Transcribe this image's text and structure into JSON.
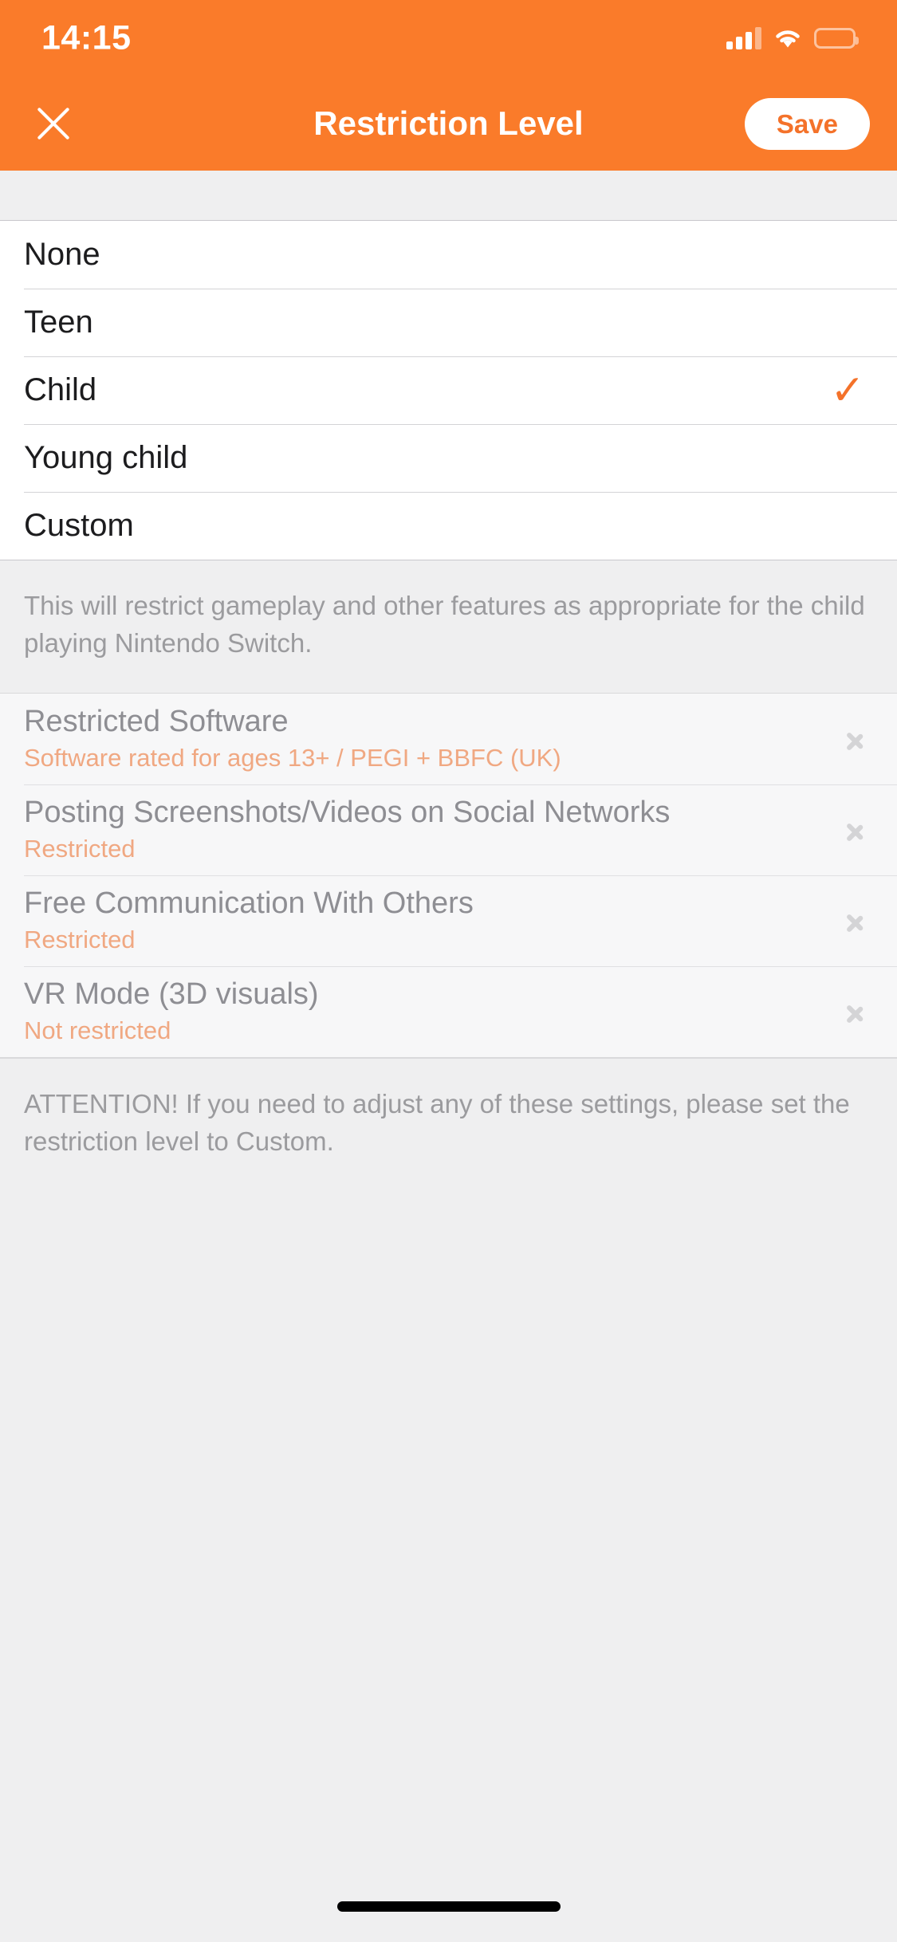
{
  "status_bar": {
    "time": "14:15",
    "signal_icon": "cellular-signal-icon",
    "wifi_icon": "wifi-icon",
    "battery_icon": "battery-icon"
  },
  "nav": {
    "close_icon": "close-x-icon",
    "title": "Restriction Level",
    "save_label": "Save"
  },
  "colors": {
    "accent_orange": "#fa7b2a",
    "save_text": "#f4722a",
    "check_orange": "#f4722a",
    "subtitle_orange": "#f0a882",
    "muted_gray": "#8e8e93",
    "note_gray": "#9b9b9e",
    "card_bg": "#ffffff",
    "sub_card_bg": "#f7f7f8",
    "page_bg": "#efeff0"
  },
  "levels": {
    "selected": "Child",
    "check_glyph": "✓",
    "options": [
      {
        "label": "None",
        "selected": false
      },
      {
        "label": "Teen",
        "selected": false
      },
      {
        "label": "Child",
        "selected": true
      },
      {
        "label": "Young child",
        "selected": false
      },
      {
        "label": "Custom",
        "selected": false
      }
    ]
  },
  "description": "This will restrict gameplay and other features as appropriate for the child playing Nintendo Switch.",
  "settings": {
    "rows": [
      {
        "title": "Restricted Software",
        "value": "Software rated for ages 13+ / PEGI + BBFC (UK)",
        "chevron_icon": "chevron-right-icon"
      },
      {
        "title": "Posting Screenshots/Videos on Social Networks",
        "value": "Restricted",
        "chevron_icon": "chevron-right-icon"
      },
      {
        "title": "Free Communication With Others",
        "value": "Restricted",
        "chevron_icon": "chevron-right-icon"
      },
      {
        "title": "VR Mode (3D visuals)",
        "value": "Not restricted",
        "chevron_icon": "chevron-right-icon"
      }
    ]
  },
  "attention_note": "ATTENTION! If you need to adjust any of these settings, please set the restriction level to Custom."
}
